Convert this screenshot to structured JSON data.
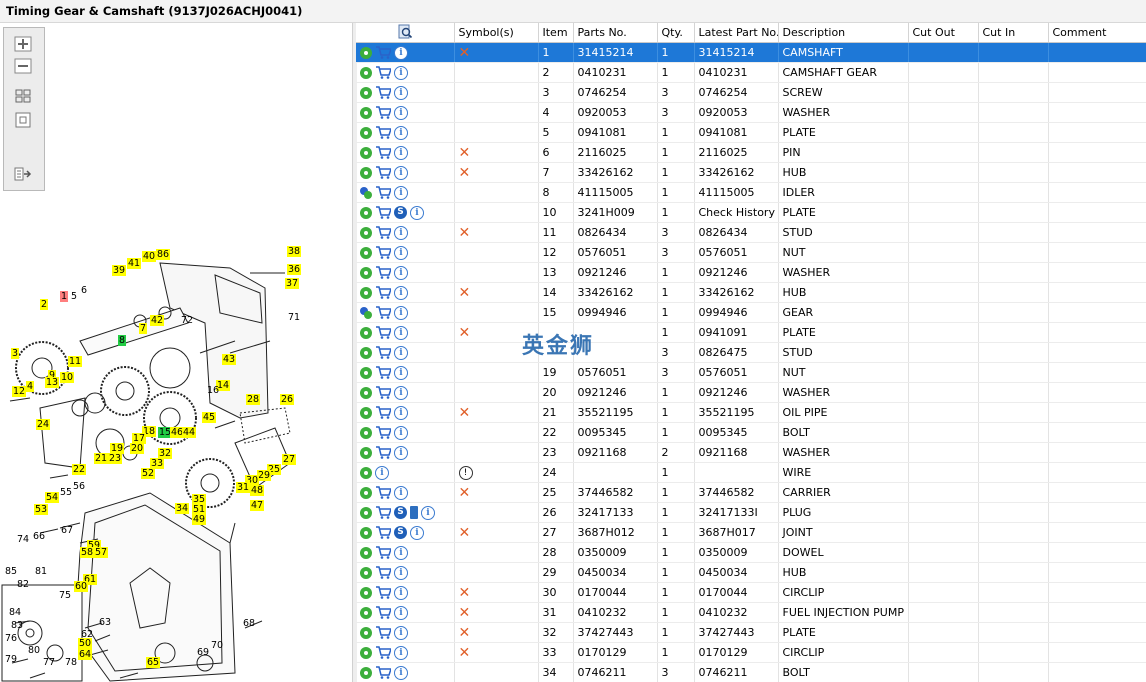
{
  "window": {
    "title": "Timing Gear & Camshaft (9137J026ACHJ0041)"
  },
  "toolbar": {
    "zoom_in": "zoom-in-icon",
    "zoom_out": "zoom-out-icon",
    "fit": "fit-all-icon",
    "actual": "actual-size-icon",
    "export": "export-icon"
  },
  "watermark": "英金狮",
  "diagram": {
    "callouts": [
      {
        "text": "38"
      },
      {
        "text": "36"
      },
      {
        "text": "37"
      },
      {
        "text": "39"
      },
      {
        "text": "41"
      },
      {
        "text": "40"
      },
      {
        "text": "86"
      },
      {
        "text": "1"
      },
      {
        "text": "5"
      },
      {
        "text": "6"
      },
      {
        "text": "2"
      },
      {
        "text": "71"
      },
      {
        "text": "42"
      },
      {
        "text": "7"
      },
      {
        "text": "72"
      },
      {
        "text": "8"
      },
      {
        "text": "3"
      },
      {
        "text": "11"
      },
      {
        "text": "9"
      },
      {
        "text": "10"
      },
      {
        "text": "13"
      },
      {
        "text": "4"
      },
      {
        "text": "12"
      },
      {
        "text": "43"
      },
      {
        "text": "14"
      },
      {
        "text": "16"
      },
      {
        "text": "28"
      },
      {
        "text": "26"
      },
      {
        "text": "45"
      },
      {
        "text": "24"
      },
      {
        "text": "18"
      },
      {
        "text": "17"
      },
      {
        "text": "15"
      },
      {
        "text": "46"
      },
      {
        "text": "44"
      },
      {
        "text": "19"
      },
      {
        "text": "20"
      },
      {
        "text": "21"
      },
      {
        "text": "23"
      },
      {
        "text": "22"
      },
      {
        "text": "32"
      },
      {
        "text": "33"
      },
      {
        "text": "27"
      },
      {
        "text": "25"
      },
      {
        "text": "29"
      },
      {
        "text": "30"
      },
      {
        "text": "52"
      },
      {
        "text": "31"
      },
      {
        "text": "48"
      },
      {
        "text": "35"
      },
      {
        "text": "34"
      },
      {
        "text": "51"
      },
      {
        "text": "49"
      },
      {
        "text": "47"
      },
      {
        "text": "56"
      },
      {
        "text": "55"
      },
      {
        "text": "54"
      },
      {
        "text": "53"
      },
      {
        "text": "67"
      },
      {
        "text": "66"
      },
      {
        "text": "59"
      },
      {
        "text": "58"
      },
      {
        "text": "57"
      },
      {
        "text": "74"
      },
      {
        "text": "85"
      },
      {
        "text": "81"
      },
      {
        "text": "82"
      },
      {
        "text": "61"
      },
      {
        "text": "60"
      },
      {
        "text": "75"
      },
      {
        "text": "84"
      },
      {
        "text": "83"
      },
      {
        "text": "63"
      },
      {
        "text": "76"
      },
      {
        "text": "62"
      },
      {
        "text": "80"
      },
      {
        "text": "50"
      },
      {
        "text": "64"
      },
      {
        "text": "79"
      },
      {
        "text": "77"
      },
      {
        "text": "78"
      },
      {
        "text": "70"
      },
      {
        "text": "69"
      },
      {
        "text": "65"
      },
      {
        "text": "68"
      }
    ]
  },
  "table": {
    "columns": [
      "",
      "Symbol(s)",
      "Item",
      "Parts No.",
      "Qty.",
      "Latest Part No.",
      "Description",
      "Cut Out",
      "Cut In",
      "Comment"
    ],
    "rows": [
      {
        "icons": [
          "gear",
          "cart",
          "info"
        ],
        "sym": "x",
        "item": "1",
        "part": "31415214",
        "qty": "1",
        "latest": "31415214",
        "desc": "CAMSHAFT",
        "sel": true
      },
      {
        "icons": [
          "gear",
          "cart",
          "info"
        ],
        "sym": "",
        "item": "2",
        "part": "0410231",
        "qty": "1",
        "latest": "0410231",
        "desc": "CAMSHAFT GEAR"
      },
      {
        "icons": [
          "gear",
          "cart",
          "info"
        ],
        "sym": "",
        "item": "3",
        "part": "0746254",
        "qty": "3",
        "latest": "0746254",
        "desc": "SCREW"
      },
      {
        "icons": [
          "gear",
          "cart",
          "info"
        ],
        "sym": "",
        "item": "4",
        "part": "0920053",
        "qty": "3",
        "latest": "0920053",
        "desc": "WASHER"
      },
      {
        "icons": [
          "gear",
          "cart",
          "info"
        ],
        "sym": "",
        "item": "5",
        "part": "0941081",
        "qty": "1",
        "latest": "0941081",
        "desc": "PLATE"
      },
      {
        "icons": [
          "gear",
          "cart",
          "info"
        ],
        "sym": "x",
        "item": "6",
        "part": "2116025",
        "qty": "1",
        "latest": "2116025",
        "desc": "PIN"
      },
      {
        "icons": [
          "gear",
          "cart",
          "info"
        ],
        "sym": "x",
        "item": "7",
        "part": "33426162",
        "qty": "1",
        "latest": "33426162",
        "desc": "HUB"
      },
      {
        "icons": [
          "gear2",
          "cart",
          "info"
        ],
        "sym": "",
        "item": "8",
        "part": "41115005",
        "qty": "1",
        "latest": "41115005",
        "desc": "IDLER"
      },
      {
        "icons": [
          "gear",
          "cart",
          "s",
          "info"
        ],
        "sym": "",
        "item": "10",
        "part": "3241H009",
        "qty": "1",
        "latest": "Check History",
        "desc": "PLATE"
      },
      {
        "icons": [
          "gear",
          "cart",
          "info"
        ],
        "sym": "x",
        "item": "11",
        "part": "0826434",
        "qty": "3",
        "latest": "0826434",
        "desc": "STUD"
      },
      {
        "icons": [
          "gear",
          "cart",
          "info"
        ],
        "sym": "",
        "item": "12",
        "part": "0576051",
        "qty": "3",
        "latest": "0576051",
        "desc": "NUT"
      },
      {
        "icons": [
          "gear",
          "cart",
          "info"
        ],
        "sym": "",
        "item": "13",
        "part": "0921246",
        "qty": "1",
        "latest": "0921246",
        "desc": "WASHER"
      },
      {
        "icons": [
          "gear",
          "cart",
          "info"
        ],
        "sym": "x",
        "item": "14",
        "part": "33426162",
        "qty": "1",
        "latest": "33426162",
        "desc": "HUB"
      },
      {
        "icons": [
          "gear2",
          "cart",
          "info"
        ],
        "sym": "",
        "item": "15",
        "part": "0994946",
        "qty": "1",
        "latest": "0994946",
        "desc": "GEAR"
      },
      {
        "icons": [
          "gear",
          "cart",
          "info"
        ],
        "sym": "x",
        "item": "",
        "part": "",
        "qty": "1",
        "latest": "0941091",
        "desc": "PLATE"
      },
      {
        "icons": [
          "gear",
          "cart",
          "info"
        ],
        "sym": "",
        "item": "",
        "part": "",
        "qty": "3",
        "latest": "0826475",
        "desc": "STUD"
      },
      {
        "icons": [
          "gear",
          "cart",
          "info"
        ],
        "sym": "",
        "item": "19",
        "part": "0576051",
        "qty": "3",
        "latest": "0576051",
        "desc": "NUT"
      },
      {
        "icons": [
          "gear",
          "cart",
          "info"
        ],
        "sym": "",
        "item": "20",
        "part": "0921246",
        "qty": "1",
        "latest": "0921246",
        "desc": "WASHER"
      },
      {
        "icons": [
          "gear",
          "cart",
          "info"
        ],
        "sym": "x",
        "item": "21",
        "part": "35521195",
        "qty": "1",
        "latest": "35521195",
        "desc": "OIL PIPE"
      },
      {
        "icons": [
          "gear",
          "cart",
          "info"
        ],
        "sym": "",
        "item": "22",
        "part": "0095345",
        "qty": "1",
        "latest": "0095345",
        "desc": "BOLT"
      },
      {
        "icons": [
          "gear",
          "cart",
          "info"
        ],
        "sym": "",
        "item": "23",
        "part": "0921168",
        "qty": "2",
        "latest": "0921168",
        "desc": "WASHER"
      },
      {
        "icons": [
          "gear",
          "info"
        ],
        "sym": "warn",
        "item": "24",
        "part": "",
        "qty": "1",
        "latest": "",
        "desc": "WIRE"
      },
      {
        "icons": [
          "gear",
          "cart",
          "info"
        ],
        "sym": "x",
        "item": "25",
        "part": "37446582",
        "qty": "1",
        "latest": "37446582",
        "desc": "CARRIER"
      },
      {
        "icons": [
          "gear",
          "cart",
          "s",
          "book",
          "info"
        ],
        "sym": "",
        "item": "26",
        "part": "32417133",
        "qty": "1",
        "latest": "32417133I",
        "desc": "PLUG"
      },
      {
        "icons": [
          "gear",
          "cart",
          "s",
          "info"
        ],
        "sym": "x",
        "item": "27",
        "part": "3687H012",
        "qty": "1",
        "latest": "3687H017",
        "desc": "JOINT"
      },
      {
        "icons": [
          "gear",
          "cart",
          "info"
        ],
        "sym": "",
        "item": "28",
        "part": "0350009",
        "qty": "1",
        "latest": "0350009",
        "desc": "DOWEL"
      },
      {
        "icons": [
          "gear",
          "cart",
          "info"
        ],
        "sym": "",
        "item": "29",
        "part": "0450034",
        "qty": "1",
        "latest": "0450034",
        "desc": "HUB"
      },
      {
        "icons": [
          "gear",
          "cart",
          "info"
        ],
        "sym": "x",
        "item": "30",
        "part": "0170044",
        "qty": "1",
        "latest": "0170044",
        "desc": "CIRCLIP"
      },
      {
        "icons": [
          "gear",
          "cart",
          "info"
        ],
        "sym": "x",
        "item": "31",
        "part": "0410232",
        "qty": "1",
        "latest": "0410232",
        "desc": "FUEL INJECTION PUMP G"
      },
      {
        "icons": [
          "gear",
          "cart",
          "info"
        ],
        "sym": "x",
        "item": "32",
        "part": "37427443",
        "qty": "1",
        "latest": "37427443",
        "desc": "PLATE"
      },
      {
        "icons": [
          "gear",
          "cart",
          "info"
        ],
        "sym": "x",
        "item": "33",
        "part": "0170129",
        "qty": "1",
        "latest": "0170129",
        "desc": "CIRCLIP"
      },
      {
        "icons": [
          "gear",
          "cart",
          "info"
        ],
        "sym": "",
        "item": "34",
        "part": "0746211",
        "qty": "3",
        "latest": "0746211",
        "desc": "BOLT"
      }
    ]
  }
}
